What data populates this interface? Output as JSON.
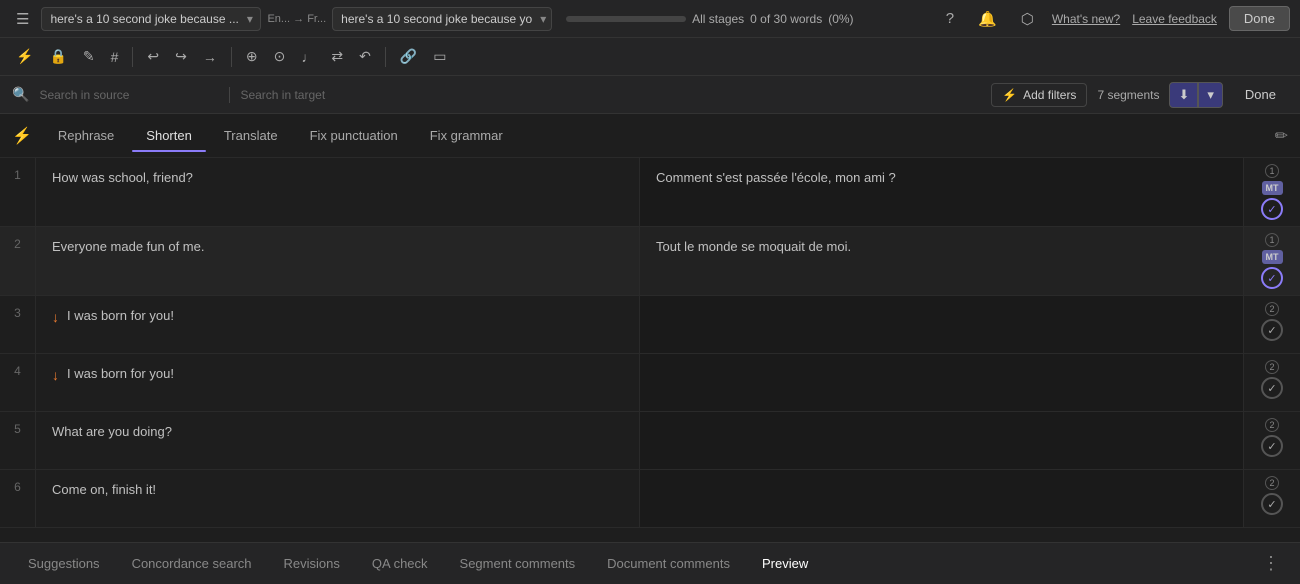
{
  "topbar": {
    "doc_title_left": "here's a 10 second joke because ...",
    "lang_pair": "En... → Fr...",
    "doc_title_right": "here's a 10 second joke because yo",
    "stages_label": "All stages",
    "word_count": "0 of 30 words",
    "word_pct": "(0%)",
    "whats_new": "What's new?",
    "leave_feedback": "Leave feedback",
    "done_label": "Done"
  },
  "toolbar": {
    "icons": [
      "⚡",
      "🔒",
      "✏️",
      "#",
      "↩",
      "↪",
      "→",
      "⊕",
      "⊙",
      "♪",
      "→",
      "↔",
      "↶",
      "📎",
      "▭"
    ]
  },
  "search": {
    "source_placeholder": "Search in source",
    "target_placeholder": "Search in target",
    "filter_label": "Add filters",
    "segments_count": "7 segments",
    "done_label": "Done"
  },
  "ai_toolbar": {
    "tabs": [
      {
        "id": "rephrase",
        "label": "Rephrase",
        "active": false
      },
      {
        "id": "shorten",
        "label": "Shorten",
        "active": true
      },
      {
        "id": "translate",
        "label": "Translate",
        "active": false
      },
      {
        "id": "fix_punctuation",
        "label": "Fix punctuation",
        "active": false
      },
      {
        "id": "fix_grammar",
        "label": "Fix grammar",
        "active": false
      }
    ]
  },
  "segments": [
    {
      "num": "1",
      "source": "How was school, friend?",
      "has_arrow": false,
      "target": "Comment s'est passée l'école, mon ami ?",
      "has_mt": true,
      "revision": "1",
      "checked": true
    },
    {
      "num": "2",
      "source": "Everyone made fun of me.",
      "has_arrow": false,
      "target": "Tout le monde se moquait de moi.",
      "has_mt": true,
      "revision": "1",
      "checked": true
    },
    {
      "num": "3",
      "source": "I was born for you!",
      "has_arrow": true,
      "target": "",
      "has_mt": false,
      "revision": "2",
      "checked": false
    },
    {
      "num": "4",
      "source": "I was born for you!",
      "has_arrow": true,
      "target": "",
      "has_mt": false,
      "revision": "2",
      "checked": false
    },
    {
      "num": "5",
      "source": "What are you doing?",
      "has_arrow": false,
      "target": "",
      "has_mt": false,
      "revision": "2",
      "checked": false
    },
    {
      "num": "6",
      "source": "Come on, finish it!",
      "has_arrow": false,
      "target": "",
      "has_mt": false,
      "revision": "2",
      "checked": false
    }
  ],
  "bottom_tabs": [
    {
      "id": "suggestions",
      "label": "Suggestions",
      "active": false
    },
    {
      "id": "concordance",
      "label": "Concordance search",
      "active": false
    },
    {
      "id": "revisions",
      "label": "Revisions",
      "active": false
    },
    {
      "id": "qa",
      "label": "QA check",
      "active": false
    },
    {
      "id": "segment_comments",
      "label": "Segment comments",
      "active": false
    },
    {
      "id": "document_comments",
      "label": "Document comments",
      "active": false
    },
    {
      "id": "preview",
      "label": "Preview",
      "active": true
    }
  ]
}
